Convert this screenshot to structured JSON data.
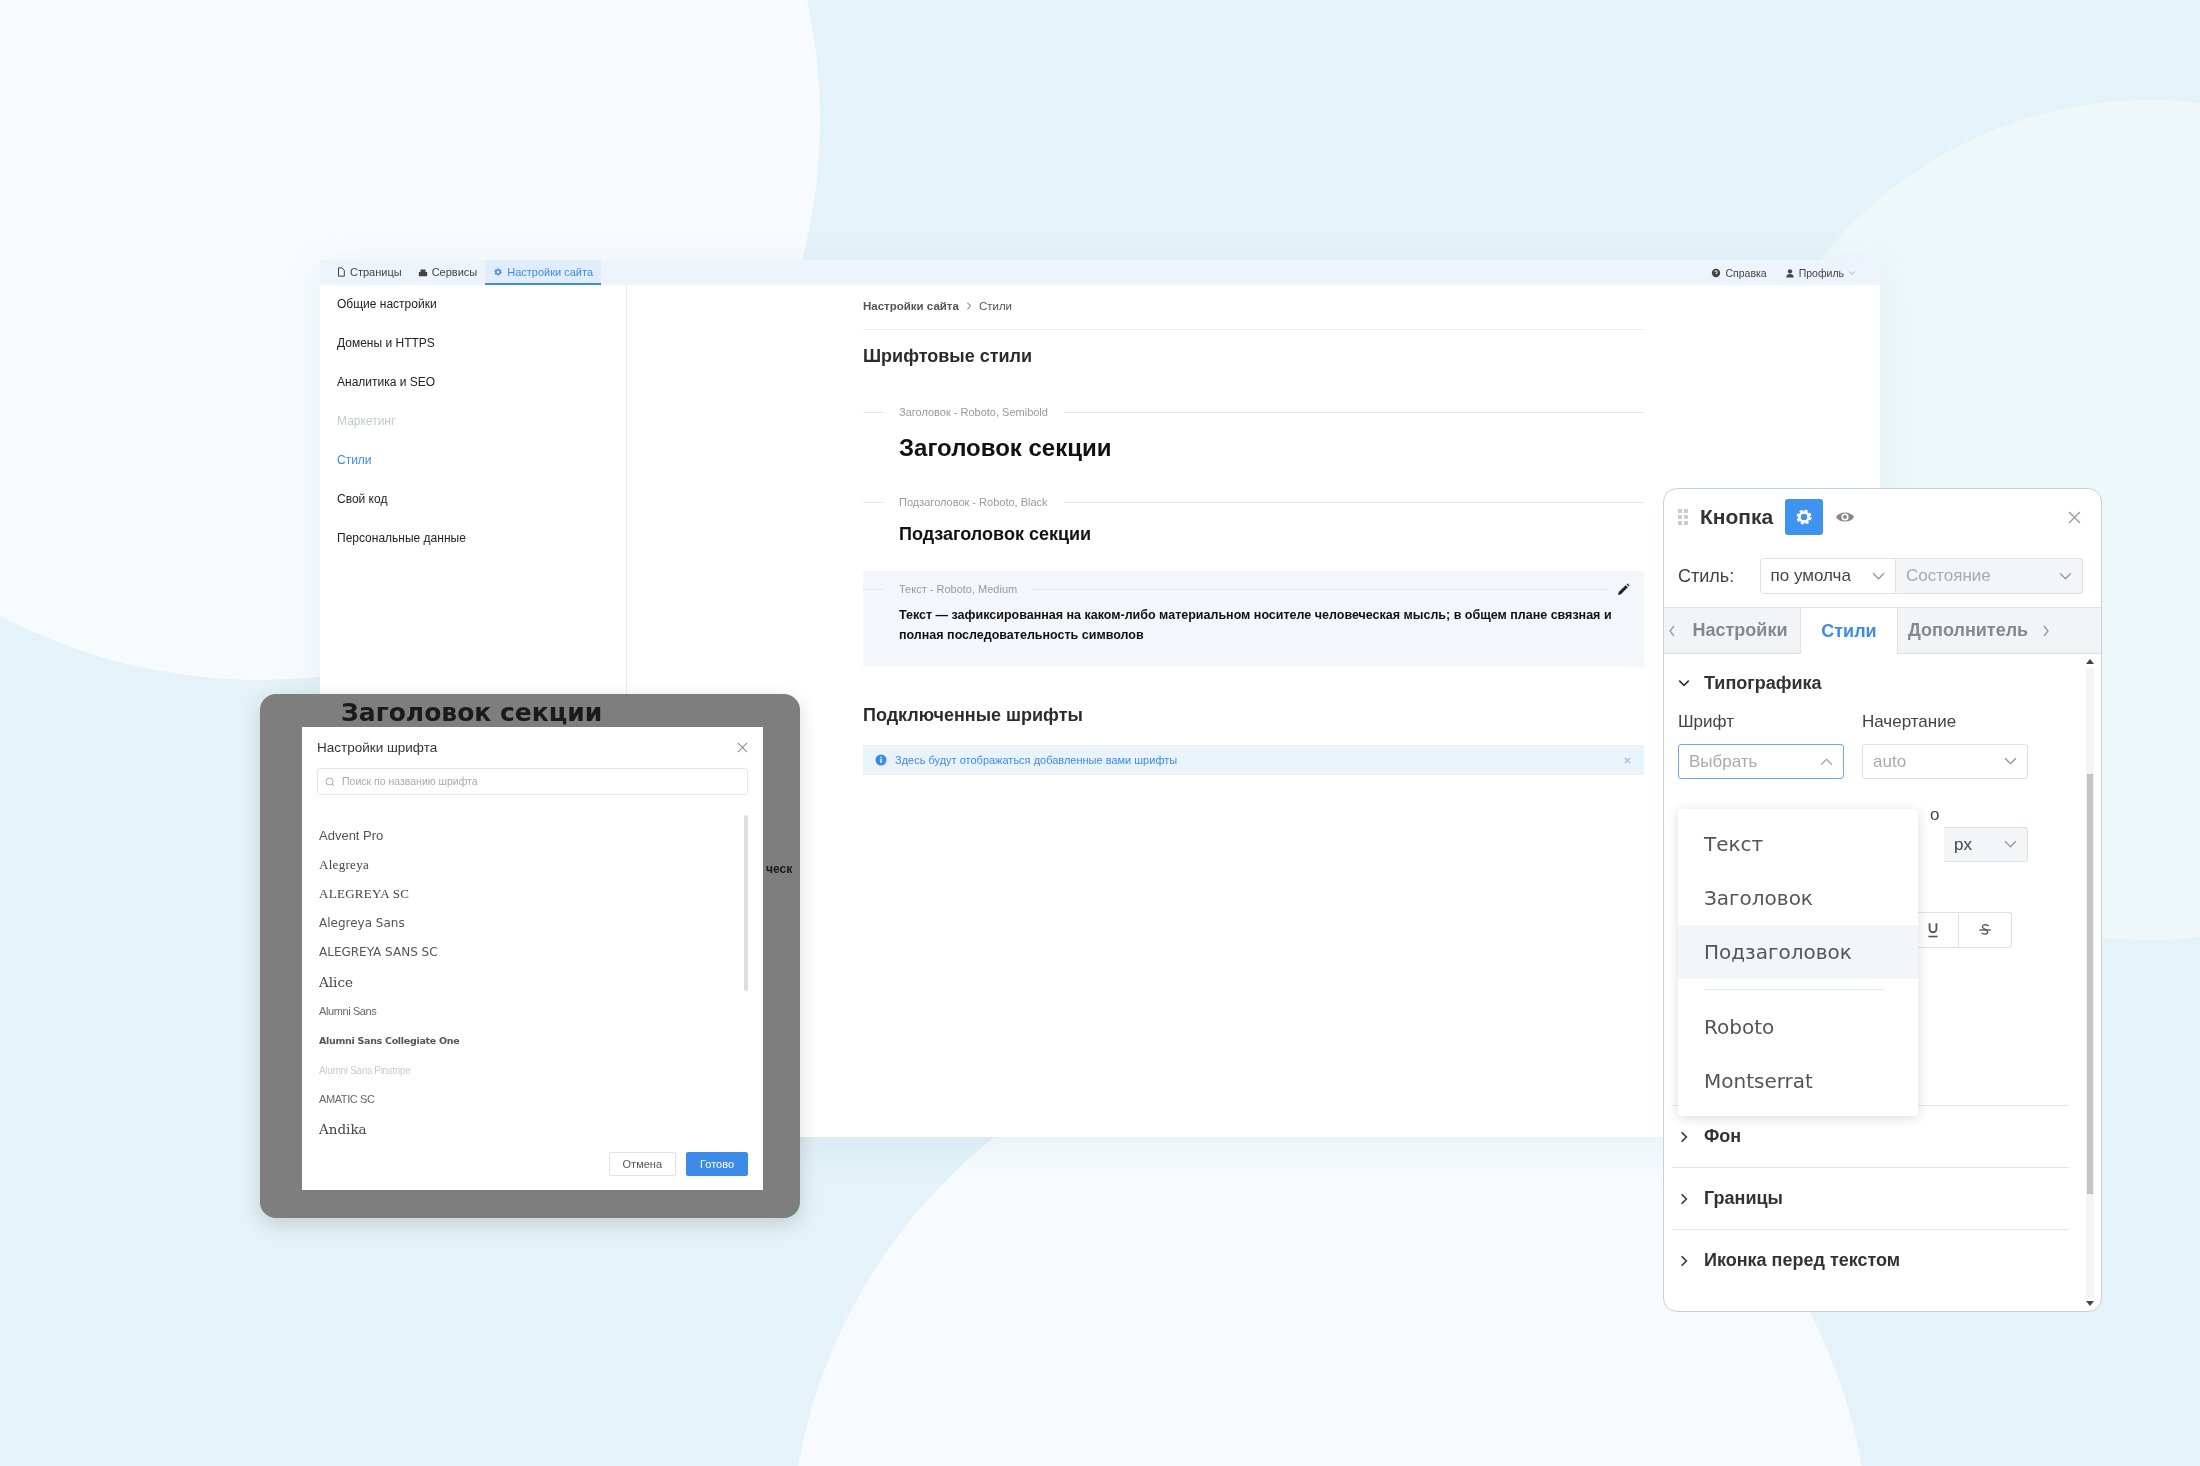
{
  "main_window": {
    "top_bar": {
      "tabs": [
        {
          "label": "Страницы",
          "selected": false
        },
        {
          "label": "Сервисы",
          "selected": false
        },
        {
          "label": "Настройки сайта",
          "selected": true
        }
      ],
      "help": "Справка",
      "profile": "Профиль"
    },
    "sidebar": {
      "items": [
        {
          "label": "Общие настройки",
          "selected": false,
          "disabled": false
        },
        {
          "label": "Домены и HTTPS",
          "selected": false,
          "disabled": false
        },
        {
          "label": "Аналитика и SEO",
          "selected": false,
          "disabled": false
        },
        {
          "label": "Маркетинг",
          "selected": false,
          "disabled": true
        },
        {
          "label": "Стили",
          "selected": true,
          "disabled": false
        },
        {
          "label": "Свой код",
          "selected": false,
          "disabled": false
        },
        {
          "label": "Персональные данные",
          "selected": false,
          "disabled": false
        }
      ]
    },
    "breadcrumb": [
      "Настройки сайта",
      "Стили"
    ],
    "font_styles": {
      "title": "Шрифтовые стили",
      "items": [
        {
          "kind": "heading",
          "caption": "Заголовок - Roboto, Semibold",
          "sample": "Заголовок секции",
          "highlighted": false
        },
        {
          "kind": "subheading",
          "caption": "Подзаголовок - Roboto, Black",
          "sample": "Подзаголовок секции",
          "highlighted": false
        },
        {
          "kind": "text",
          "caption": "Текст - Roboto, Medium",
          "sample": "Текст — зафиксированная на каком-либо материальном носителе человеческая мысль; в общем плане связная и полная последовательность символов",
          "highlighted": true
        }
      ]
    },
    "connected_fonts": {
      "title": "Подключенные шрифты",
      "notice": "Здесь будут отображаться добавленные вами шрифты"
    }
  },
  "font_dialog": {
    "background_heading": "Заголовок секции",
    "background_fragment": "ческ",
    "title": "Настройки шрифта",
    "search": {
      "placeholder": "Поиск по названию шрифта"
    },
    "fonts": [
      {
        "name": "Advent Pro",
        "kind": "light"
      },
      {
        "name": "Alegreya",
        "kind": "serif"
      },
      {
        "name": "ALEGREYA SC",
        "kind": "serif"
      },
      {
        "name": "Alegreya Sans",
        "kind": "sans"
      },
      {
        "name": "ALEGREYA SANS SC",
        "kind": "sans"
      },
      {
        "name": "Alice",
        "kind": "display"
      },
      {
        "name": "Alumni Sans",
        "kind": "condensed"
      },
      {
        "name": "Alumni Sans Collegiate One",
        "kind": "heavy"
      },
      {
        "name": "Alumni Sans Pinstripe",
        "kind": "hairline"
      },
      {
        "name": "AMATIC SC",
        "kind": "condensed"
      },
      {
        "name": "Andika",
        "kind": "display"
      }
    ],
    "buttons": [
      {
        "label": "Отмена",
        "primary": false
      },
      {
        "label": "Готово",
        "primary": true
      }
    ]
  },
  "element_panel": {
    "title": "Кнопка",
    "style_label": "Стиль:",
    "style_value": "по умолча",
    "state_placeholder": "Состояние",
    "tabs": [
      {
        "label": "Настройки",
        "selected": false
      },
      {
        "label": "Стили",
        "selected": true
      },
      {
        "label": "Дополнитель",
        "selected": false
      }
    ],
    "typography": {
      "title": "Типографика",
      "expanded": true,
      "font_label": "Шрифт",
      "font_placeholder": "Выбрать",
      "weight_label": "Начертание",
      "weight_value": "auto",
      "size_label": "о",
      "unit": "px"
    },
    "dropdown": {
      "groups": [
        {
          "options": [
            {
              "label": "Текст",
              "highlighted": false
            },
            {
              "label": "Заголовок",
              "highlighted": false
            },
            {
              "label": "Подзаголовок",
              "highlighted": true
            }
          ]
        },
        {
          "options": [
            {
              "label": "Roboto",
              "highlighted": false
            },
            {
              "label": "Montserrat",
              "highlighted": false
            }
          ]
        }
      ]
    },
    "sections": [
      {
        "title": "Фон",
        "expanded": false
      },
      {
        "title": "Границы",
        "expanded": false
      },
      {
        "title": "Иконка перед текстом",
        "expanded": false
      }
    ]
  }
}
